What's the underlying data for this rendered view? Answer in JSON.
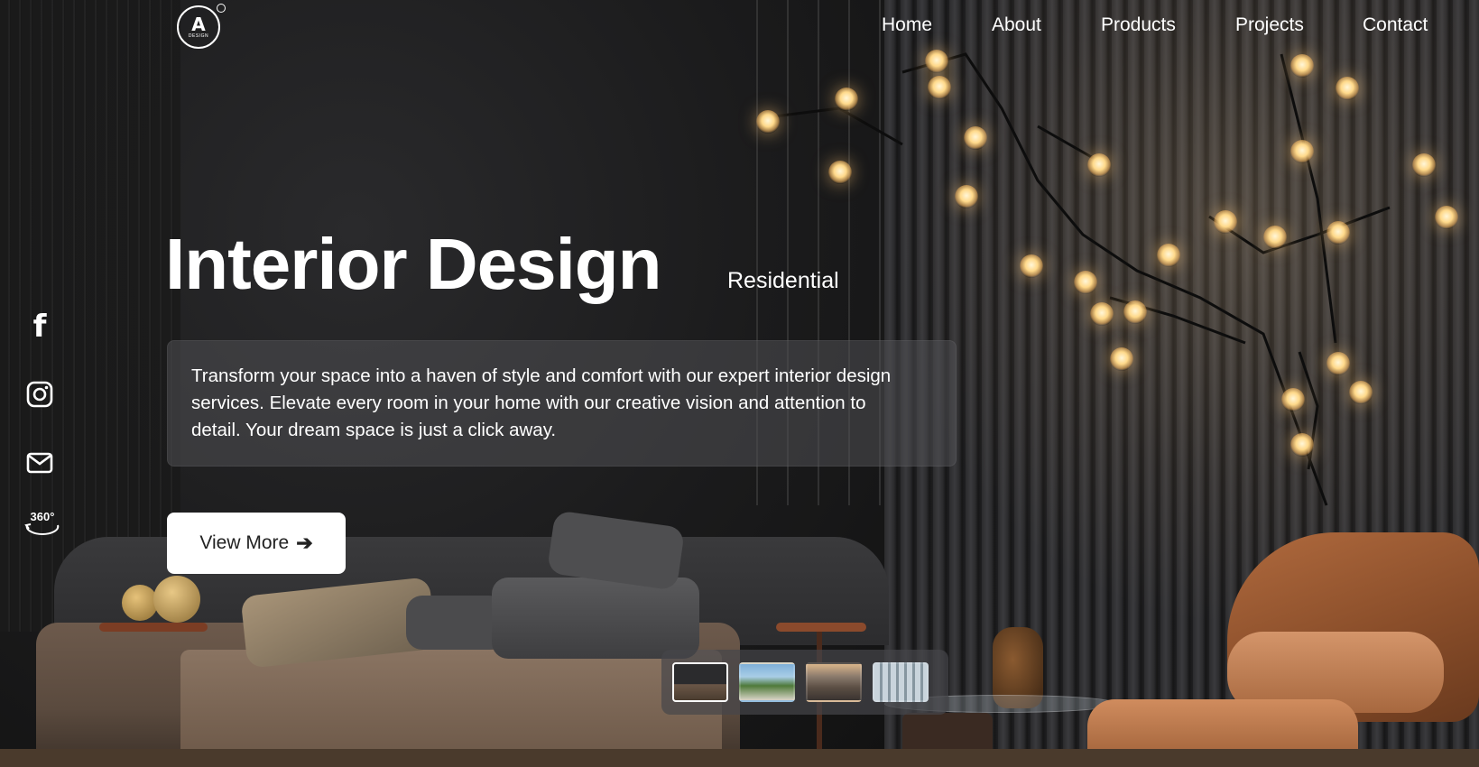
{
  "brand": {
    "logo_mark": "A",
    "logo_sub": "DESIGN"
  },
  "nav": {
    "items": [
      {
        "label": "Home"
      },
      {
        "label": "About"
      },
      {
        "label": "Products"
      },
      {
        "label": "Projects"
      },
      {
        "label": "Contact"
      }
    ]
  },
  "hero": {
    "title": "Interior Design",
    "subtitle": "Residential",
    "description": "Transform your space into a haven of style and comfort with our expert interior design services. Elevate every room in your home with our creative vision and attention to detail. Your dream space is just a click away.",
    "cta_label": "View More",
    "cta_arrow": "➔"
  },
  "social": {
    "items": [
      {
        "name": "facebook-icon",
        "glyph": "f"
      },
      {
        "name": "instagram-icon"
      },
      {
        "name": "mail-icon"
      },
      {
        "name": "tour-360-icon",
        "text": "360°"
      }
    ]
  },
  "thumbnails": {
    "selected_index": 0,
    "items": [
      {
        "name": "thumbnail-bedroom"
      },
      {
        "name": "thumbnail-house-exterior"
      },
      {
        "name": "thumbnail-building-sunset"
      },
      {
        "name": "thumbnail-glass-interior"
      }
    ]
  },
  "colors": {
    "text": "#ffffff",
    "button_bg": "#ffffff",
    "button_text": "#222222",
    "panel_bg": "rgba(80,80,84,0.55)"
  }
}
